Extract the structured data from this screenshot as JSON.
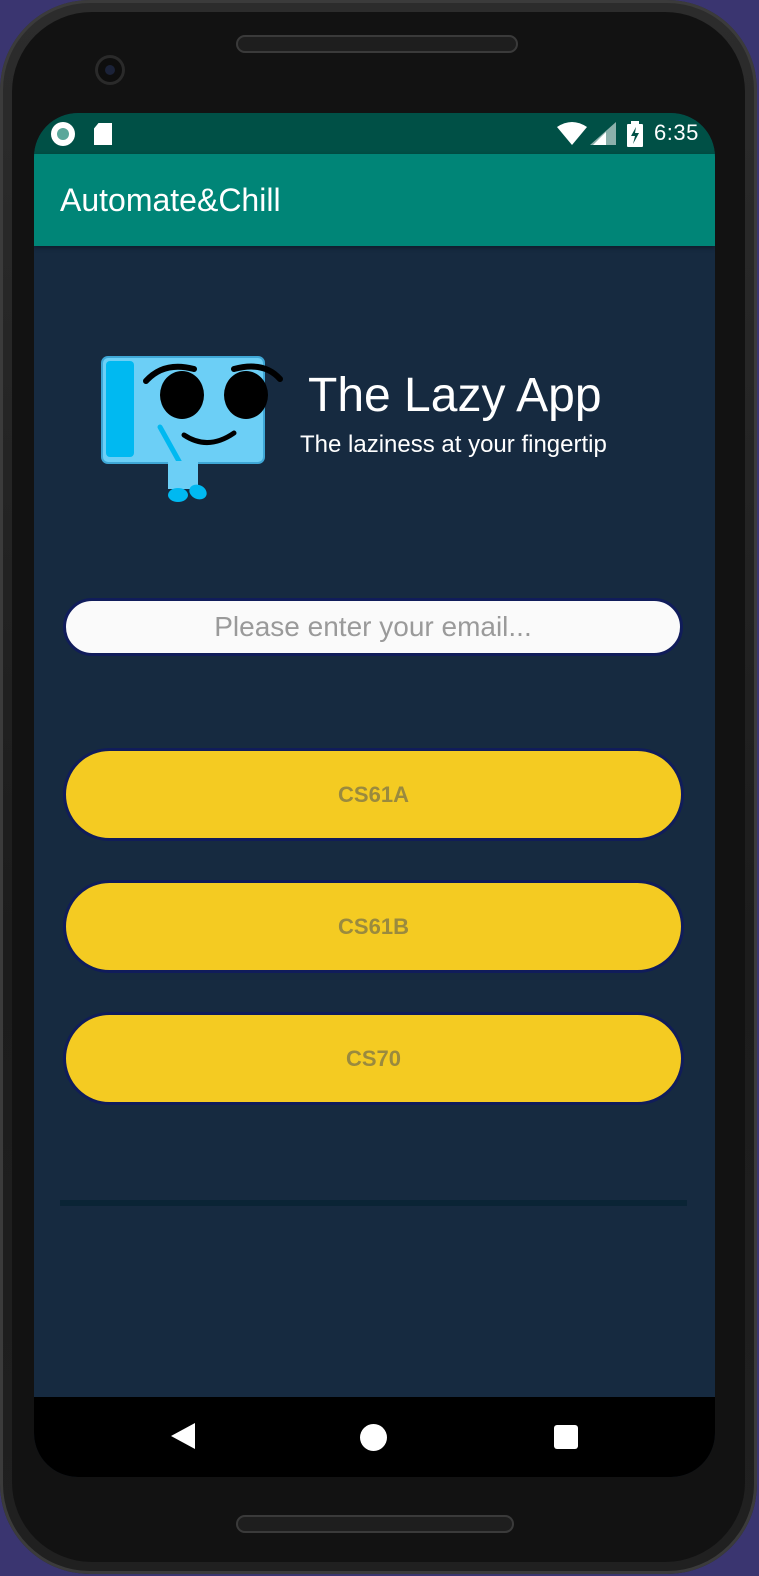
{
  "status_bar": {
    "time": "6:35",
    "icons": [
      "notification-dot-icon",
      "sd-card-icon",
      "wifi-icon",
      "signal-icon",
      "battery-charging-icon"
    ]
  },
  "app_bar": {
    "title": "Automate&Chill"
  },
  "hero": {
    "logo": "lazy-mascot-icon",
    "title": "The Lazy App",
    "subtitle": "The laziness at your fingertip"
  },
  "email": {
    "placeholder": "Please enter your email...",
    "value": ""
  },
  "courses": [
    {
      "label": "CS61A"
    },
    {
      "label": "CS61B"
    },
    {
      "label": "CS70"
    }
  ],
  "nav_bar": {
    "icons": [
      "back-icon",
      "home-icon",
      "recents-icon"
    ]
  },
  "colors": {
    "status_bar": "#005046",
    "app_bar": "#008577",
    "background": "#162a40",
    "button": "#f4cb22",
    "button_text": "#9a8a3e"
  }
}
